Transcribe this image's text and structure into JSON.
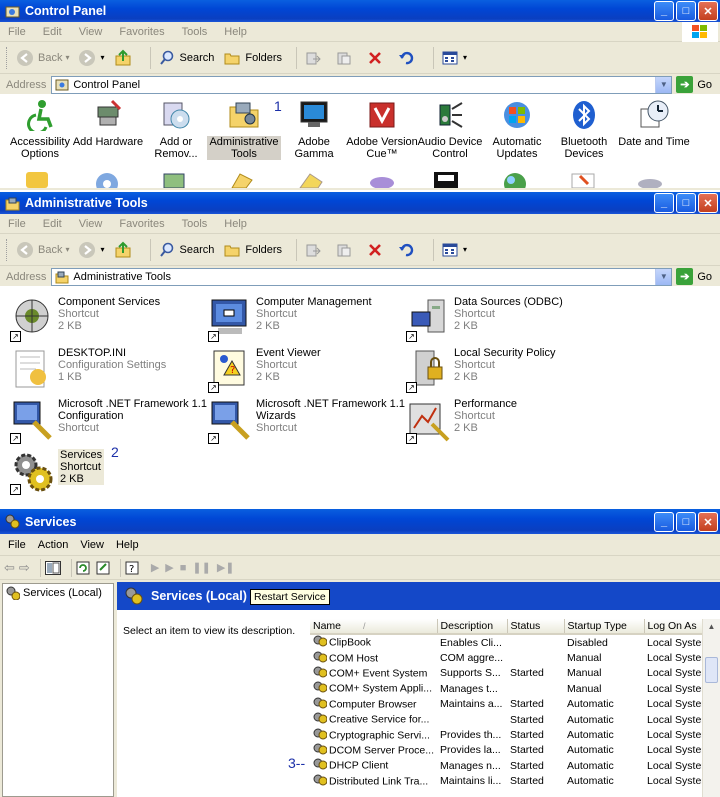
{
  "colors": {
    "titlebar": "#0a5fe0",
    "header_blue": "#1448c8",
    "note_blue": "#1b2fa8",
    "window_bg": "#ece9d8"
  },
  "window_buttons": {
    "minimize": "_",
    "maximize": "□",
    "close": "✕"
  },
  "cp": {
    "title": "Control Panel",
    "menu": [
      "File",
      "Edit",
      "View",
      "Favorites",
      "Tools",
      "Help"
    ],
    "toolbar": {
      "back": "Back",
      "search": "Search",
      "folders": "Folders"
    },
    "address_label": "Address",
    "address": "Control Panel",
    "go": "Go",
    "items": [
      {
        "l1": "Accessibility",
        "l2": "Options"
      },
      {
        "l1": "Add Hardware",
        "l2": ""
      },
      {
        "l1": "Add or",
        "l2": "Remov..."
      },
      {
        "l1": "Administrative",
        "l2": "Tools"
      },
      {
        "l1": "Adobe Gamma",
        "l2": ""
      },
      {
        "l1": "Adobe Version",
        "l2": "Cue™"
      },
      {
        "l1": "Audio Device",
        "l2": "Control"
      },
      {
        "l1": "Automatic",
        "l2": "Updates"
      },
      {
        "l1": "Bluetooth",
        "l2": "Devices"
      },
      {
        "l1": "Date and Time",
        "l2": ""
      }
    ],
    "note": "1"
  },
  "at": {
    "title": "Administrative Tools",
    "menu": [
      "File",
      "Edit",
      "View",
      "Favorites",
      "Tools",
      "Help"
    ],
    "toolbar": {
      "back": "Back",
      "search": "Search",
      "folders": "Folders"
    },
    "address_label": "Address",
    "address": "Administrative Tools",
    "go": "Go",
    "items": [
      {
        "name": "Component Services",
        "type": "Shortcut",
        "size": "2 KB"
      },
      {
        "name": "Computer Management",
        "type": "Shortcut",
        "size": "2 KB"
      },
      {
        "name": "Data Sources (ODBC)",
        "type": "Shortcut",
        "size": "2 KB"
      },
      {
        "name": "DESKTOP.INI",
        "type": "Configuration Settings",
        "size": "1 KB"
      },
      {
        "name": "Event Viewer",
        "type": "Shortcut",
        "size": "2 KB"
      },
      {
        "name": "Local Security Policy",
        "type": "Shortcut",
        "size": "2 KB"
      },
      {
        "name": "Microsoft .NET Framework 1.1",
        "name2": "Configuration",
        "type": "Shortcut"
      },
      {
        "name": "Microsoft .NET Framework 1.1",
        "name2": "Wizards",
        "type": "Shortcut"
      },
      {
        "name": "Performance",
        "type": "Shortcut",
        "size": "2 KB"
      },
      {
        "name": "Services",
        "type": "Shortcut",
        "size": "2 KB"
      }
    ],
    "note": "2"
  },
  "svc": {
    "title": "Services",
    "menu": [
      "File",
      "Action",
      "View",
      "Help"
    ],
    "tree_item": "Services (Local)",
    "header": "Services (Local)",
    "tooltip": "Restart Service",
    "desc": "Select an item to view its description.",
    "note": "3--",
    "columns": [
      "Name",
      "Description",
      "Status",
      "Startup Type",
      "Log On As"
    ],
    "rows": [
      [
        "ClipBook",
        "Enables Cli...",
        "",
        "Disabled",
        "Local System"
      ],
      [
        "COM Host",
        "COM aggre...",
        "",
        "Manual",
        "Local System"
      ],
      [
        "COM+ Event System",
        "Supports S...",
        "Started",
        "Manual",
        "Local System"
      ],
      [
        "COM+ System Appli...",
        "Manages t...",
        "",
        "Manual",
        "Local System"
      ],
      [
        "Computer Browser",
        "Maintains a...",
        "Started",
        "Automatic",
        "Local System"
      ],
      [
        "Creative Service for...",
        "",
        "Started",
        "Automatic",
        "Local System"
      ],
      [
        "Cryptographic Servi...",
        "Provides th...",
        "Started",
        "Automatic",
        "Local System"
      ],
      [
        "DCOM Server Proce...",
        "Provides la...",
        "Started",
        "Automatic",
        "Local System"
      ],
      [
        "DHCP Client",
        "Manages n...",
        "Started",
        "Automatic",
        "Local System"
      ],
      [
        "Distributed Link Tra...",
        "Maintains li...",
        "Started",
        "Automatic",
        "Local System"
      ]
    ]
  }
}
